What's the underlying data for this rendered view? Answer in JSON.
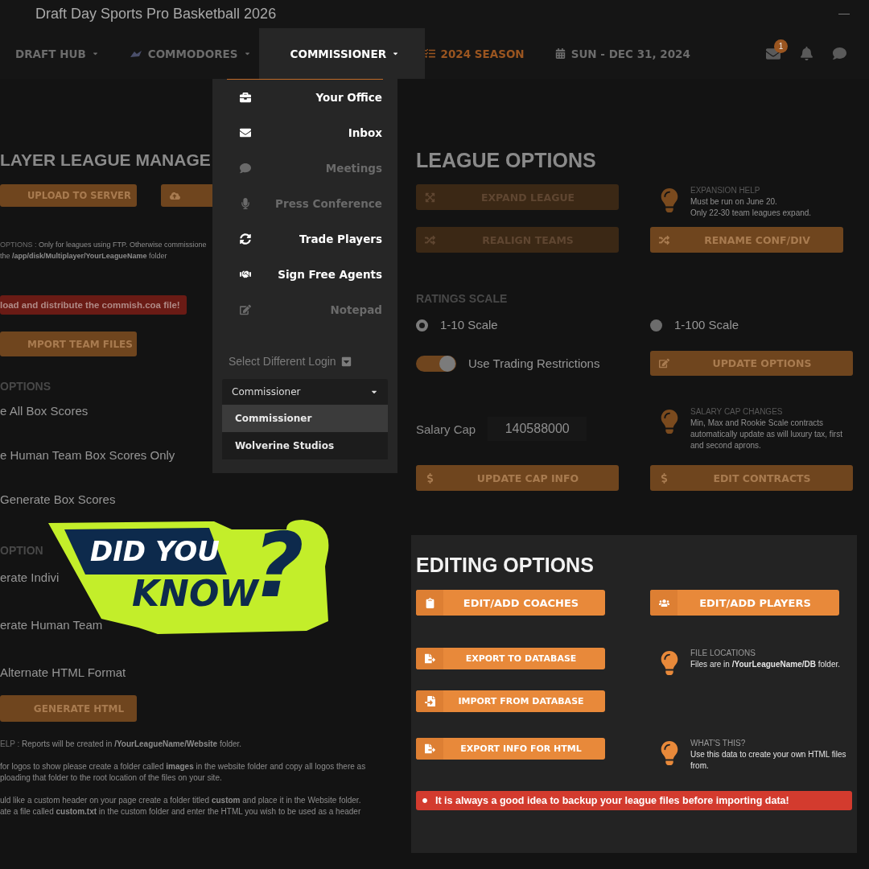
{
  "window": {
    "title": "Draft Day Sports Pro Basketball 2026"
  },
  "nav": [
    {
      "label": "DRAFT HUB",
      "kind": "menu",
      "selected": false
    },
    {
      "label": "COMMODORES",
      "kind": "team",
      "selected": false
    },
    {
      "label": "COMMISSIONER",
      "kind": "menu",
      "selected": true
    },
    {
      "label": "2024 SEASON",
      "kind": "season",
      "selected": false
    },
    {
      "label": "SUN - DEC 31, 2024",
      "kind": "date",
      "selected": false
    }
  ],
  "notifications": {
    "mail_badge": "1"
  },
  "commissioner_menu": {
    "items": [
      {
        "label": "Your Office",
        "kind": "office",
        "disabled": false
      },
      {
        "label": "Inbox",
        "kind": "inbox",
        "disabled": false
      },
      {
        "label": "Meetings",
        "kind": "meetings",
        "disabled": true
      },
      {
        "label": "Press Conference",
        "kind": "press",
        "disabled": true
      },
      {
        "label": "Trade Players",
        "kind": "trade",
        "disabled": false
      },
      {
        "label": "Sign Free Agents",
        "kind": "agents",
        "disabled": false
      },
      {
        "label": "Notepad",
        "kind": "notepad",
        "disabled": true
      }
    ],
    "login_label": "Select Different Login",
    "login_select": {
      "value": "Commissioner",
      "options": [
        {
          "label": "Commissioner",
          "selected": true
        },
        {
          "label": "Wolverine Studios",
          "selected": false
        }
      ]
    }
  },
  "multiplayer": {
    "title": "LAYER LEAGUE MANAGE",
    "buttons": [
      {
        "label": "UPLOAD TO SERVER",
        "kind": "plain"
      },
      {
        "kind": "cloud"
      }
    ],
    "ftp_note": {
      "label": "OPTIONS :",
      "lines": [
        "Only for leagues using FTP. Otherwise commissione",
        "the **/app/disk/Multiplayer/YourLeagueName** folder"
      ]
    },
    "alert": "load and distribute the commish.coa file!",
    "import_button": "MPORT TEAM FILES",
    "box_score_heading": "OPTIONS",
    "box_score_options": [
      "e All Box Scores",
      "e Human Team Box Scores Only",
      "Generate Box Scores"
    ],
    "html_heading": "OPTION",
    "html_options": [
      "erate Indivi",
      "erate Human Team",
      "Alternate HTML Format"
    ],
    "generate_button": "GENERATE HTML",
    "help": [
      {
        "label": "ELP :",
        "lines": [
          "Reports will be created in **/YourLeagueName/Website** folder."
        ]
      },
      {
        "lines": [
          "for logos to show please create a folder called **images** in the website folder and copy all logos there as",
          "ploading that folder to the root location of the files on your site."
        ]
      },
      {
        "lines": [
          "uld like a custom header on your page create a folder titled **custom** and place it in the Website folder.",
          "ate a file called **custom.txt** in the custom folder and enter the HTML you wish to be used as a header"
        ]
      }
    ]
  },
  "league_options": {
    "title": "LEAGUE OPTIONS",
    "expand_button": {
      "label": "EXPAND LEAGUE",
      "kind": "expand",
      "disabled": true
    },
    "expansion_tip": {
      "heading": "EXPANSION HELP",
      "lines": [
        "Must be run on June 20.",
        "Only 22-30 team leagues expand."
      ]
    },
    "realign_button": {
      "label": "REALIGN TEAMS",
      "kind": "shuffle",
      "disabled": true
    },
    "rename_button": {
      "label": "RENAME CONF/DIV",
      "kind": "shuffle",
      "disabled": false
    },
    "ratings_heading": "RATINGS SCALE",
    "ratings": [
      {
        "label": "1-10 Scale",
        "selected": true
      },
      {
        "label": "1-100 Scale",
        "selected": false
      }
    ],
    "trading_restrictions": {
      "label": "Use Trading Restrictions",
      "on": true
    },
    "update_options_button": {
      "label": "UPDATE OPTIONS",
      "kind": "edit",
      "disabled": false
    },
    "salary_cap": {
      "label": "Salary Cap",
      "value": "140588000"
    },
    "salary_tip": {
      "heading": "SALARY CAP CHANGES",
      "lines": [
        "Min, Max and Rookie Scale contracts",
        "automatically update as will luxury tax, first",
        "and second aprons."
      ]
    },
    "cap_buttons": [
      {
        "label": "UPDATE CAP INFO",
        "kind": "money",
        "disabled": false
      },
      {
        "label": "EDIT CONTRACTS",
        "kind": "money",
        "disabled": false
      }
    ]
  },
  "editing_options": {
    "title": "EDITING OPTIONS",
    "top_buttons": [
      {
        "label": "EDIT/ADD COACHES",
        "kind": "clipboard"
      },
      {
        "label": "EDIT/ADD PLAYERS",
        "kind": "users"
      }
    ],
    "rows": [
      {
        "button": {
          "label": "EXPORT TO DATABASE",
          "kind": "export"
        },
        "tip": {
          "heading": "FILE LOCATIONS",
          "lines": [
            "Files are in **/YourLeagueName/DB** folder."
          ]
        }
      },
      {
        "button": {
          "label": "IMPORT FROM DATABASE",
          "kind": "import"
        }
      },
      {
        "button": {
          "label": "EXPORT INFO FOR HTML",
          "kind": "export"
        },
        "tip": {
          "heading": "WHAT'S THIS?",
          "lines": [
            "Use this data to create your own HTML files",
            "from."
          ]
        }
      }
    ],
    "alert": "It is always a good idea to backup your league files before importing data!"
  },
  "promo": {
    "line_1": "DID YOU",
    "line_2": "KNOW",
    "mark": "?"
  }
}
